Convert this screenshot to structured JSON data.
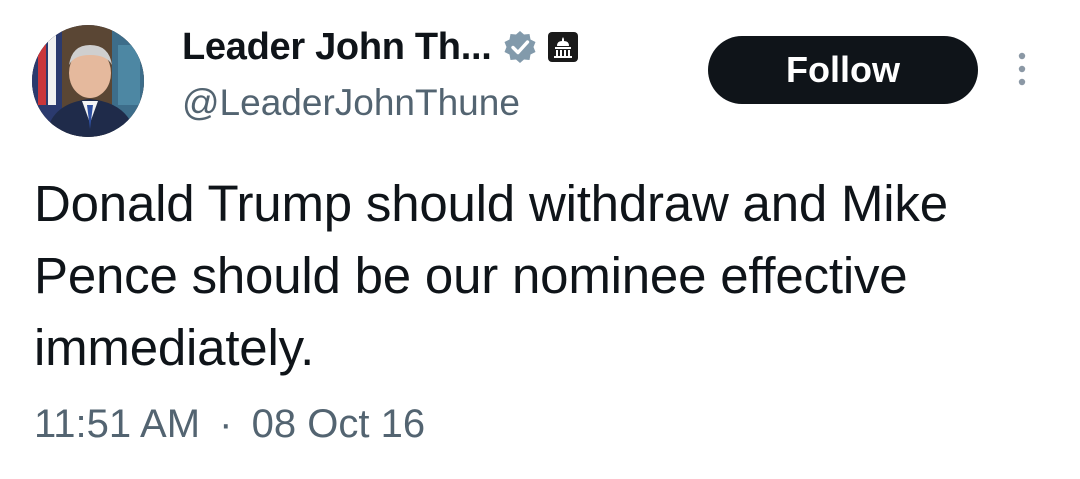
{
  "author": {
    "display_name": "Leader John Th...",
    "handle": "@LeaderJohnThune",
    "avatar_icon": "profile-photo",
    "verified_icon": "verified-badge-icon",
    "affiliate_icon": "capitol-building-icon",
    "verified_color": "#829aab"
  },
  "actions": {
    "follow_label": "Follow",
    "more_icon": "more-options-icon"
  },
  "tweet": {
    "text": "Donald Trump should withdraw and Mike Pence should be our nominee effective immediately.",
    "time": "11:51 AM",
    "separator": "·",
    "date": "08 Oct 16"
  },
  "colors": {
    "text": "#0f1419",
    "secondary": "#536471",
    "button_bg": "#0f1419",
    "button_text": "#ffffff"
  }
}
